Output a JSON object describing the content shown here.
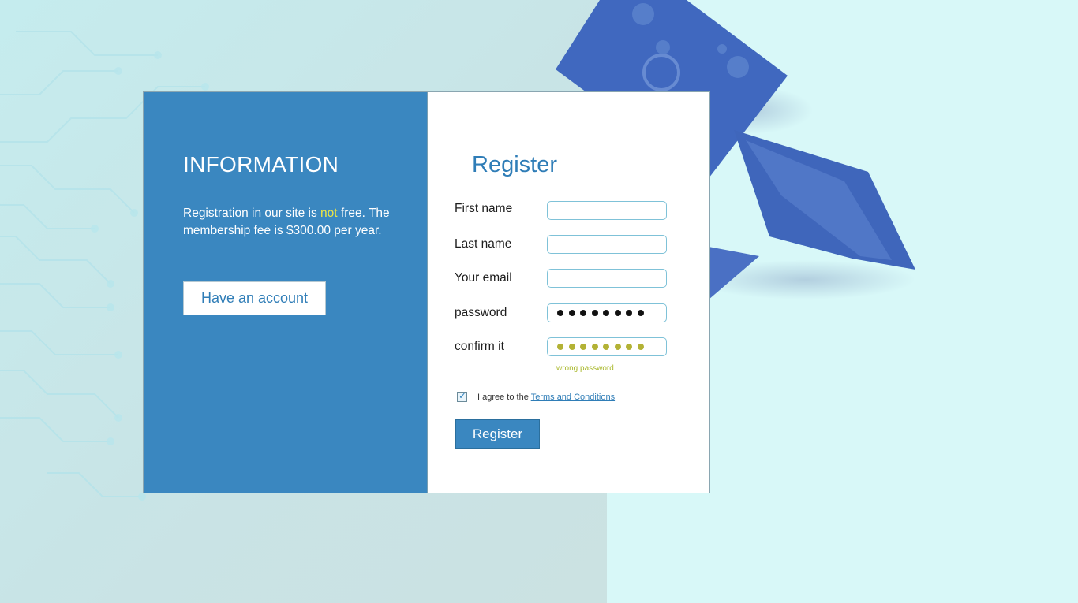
{
  "info": {
    "title": "INFORMATION",
    "text_before": "Registration in our site is ",
    "text_highlight": "not",
    "text_after": " free. The membership fee is $300.00 per year.",
    "have_account_label": "Have an account"
  },
  "register": {
    "title": "Register",
    "fields": [
      {
        "label": "First name",
        "value": ""
      },
      {
        "label": "Last name",
        "value": ""
      },
      {
        "label": "Your email",
        "value": ""
      },
      {
        "label": "password",
        "masked_length": 8
      },
      {
        "label": "confirm it",
        "masked_length": 8
      }
    ],
    "error_message": "wrong password",
    "agree_checked": true,
    "agree_text": "I agree to the ",
    "terms_link": "Terms and Conditions",
    "submit_label": "Register"
  },
  "colors": {
    "accent": "#3a87c0",
    "highlight": "#ebe545",
    "error": "#a9b82c"
  }
}
